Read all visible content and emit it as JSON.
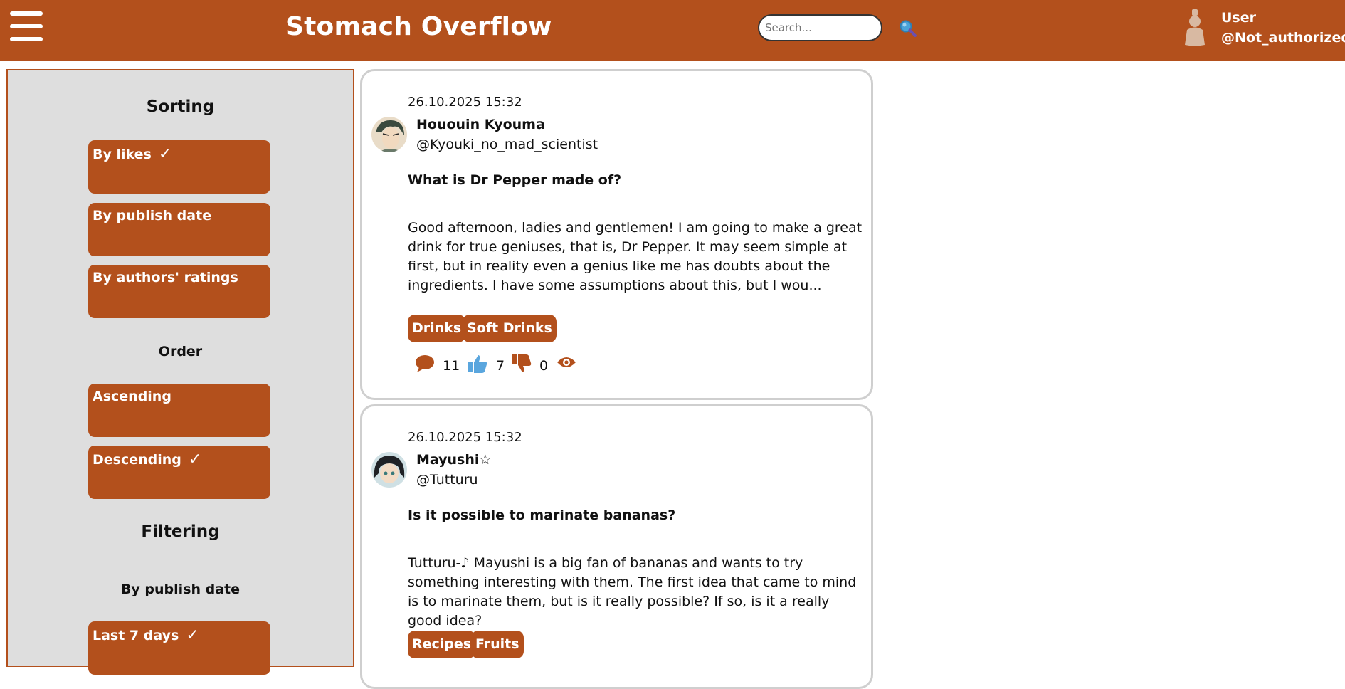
{
  "header": {
    "brand": "Stomach Overflow",
    "search_placeholder": "Search...",
    "user_name": "User",
    "user_handle": "@Not_authorized"
  },
  "sidebar": {
    "sorting_heading": "Sorting",
    "sort_options": [
      {
        "label": "By likes",
        "selected": true
      },
      {
        "label": "By publish date",
        "selected": false
      },
      {
        "label": "By authors' ratings",
        "selected": false
      }
    ],
    "order_heading": "Order",
    "order_options": [
      {
        "label": "Ascending",
        "selected": false
      },
      {
        "label": "Descending",
        "selected": true
      }
    ],
    "filtering_heading": "Filtering",
    "filter_date_heading": "By publish date",
    "filter_date_options": [
      {
        "label": "Last 7 days",
        "selected": true
      }
    ],
    "check_mark": "✓"
  },
  "posts": [
    {
      "date": "26.10.2025 15:32",
      "author": "Hououin Kyouma",
      "handle": "@Kyouki_no_mad_scientist",
      "title": "What is Dr Pepper made of?",
      "body": "Good afternoon, ladies and gentlemen! I am going to make a great drink for true geniuses, that is, Dr Pepper. It may seem simple at first, but in reality even a genius like me has doubts about the ingredients. I have some assumptions about this, but I wou...",
      "tags": [
        "Drinks",
        "Soft Drinks"
      ],
      "comments": "11",
      "likes": "7",
      "dislikes": "0"
    },
    {
      "date": "26.10.2025 15:32",
      "author": "Mayushi☆",
      "handle": "@Tutturu",
      "title": "Is it possible to marinate bananas?",
      "body": "Tutturu-♪ Mayushi is a big fan of bananas and wants to try something interesting with them. The first idea that came to mind is to marinate them, but is it really possible? If so, is it a really good idea?",
      "tags": [
        "Recipes",
        "Fruits"
      ]
    }
  ],
  "colors": {
    "brand": "#b3501c",
    "sidebar_bg": "#dedede",
    "card_border": "#cfcfcf",
    "like_blue": "#5aa6de"
  }
}
